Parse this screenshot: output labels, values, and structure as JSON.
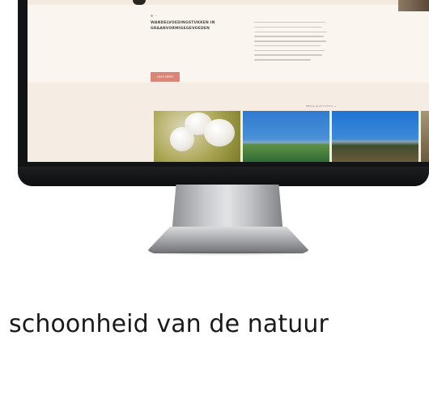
{
  "caption": "schoonheid van de natuur",
  "website": {
    "meta": "—",
    "title": "WANDELVOEDINGSTUKKEN IN GRAANVORMIGEGEVOEDEN",
    "cta": "LEES MEER",
    "more_link": "BEKIJK ALLE FOTO'S →",
    "photos": [
      "cotton",
      "field",
      "field"
    ]
  },
  "colors": {
    "screen_bg": "#faf4ee",
    "cta": "#d98578",
    "bezel": "#121416"
  }
}
